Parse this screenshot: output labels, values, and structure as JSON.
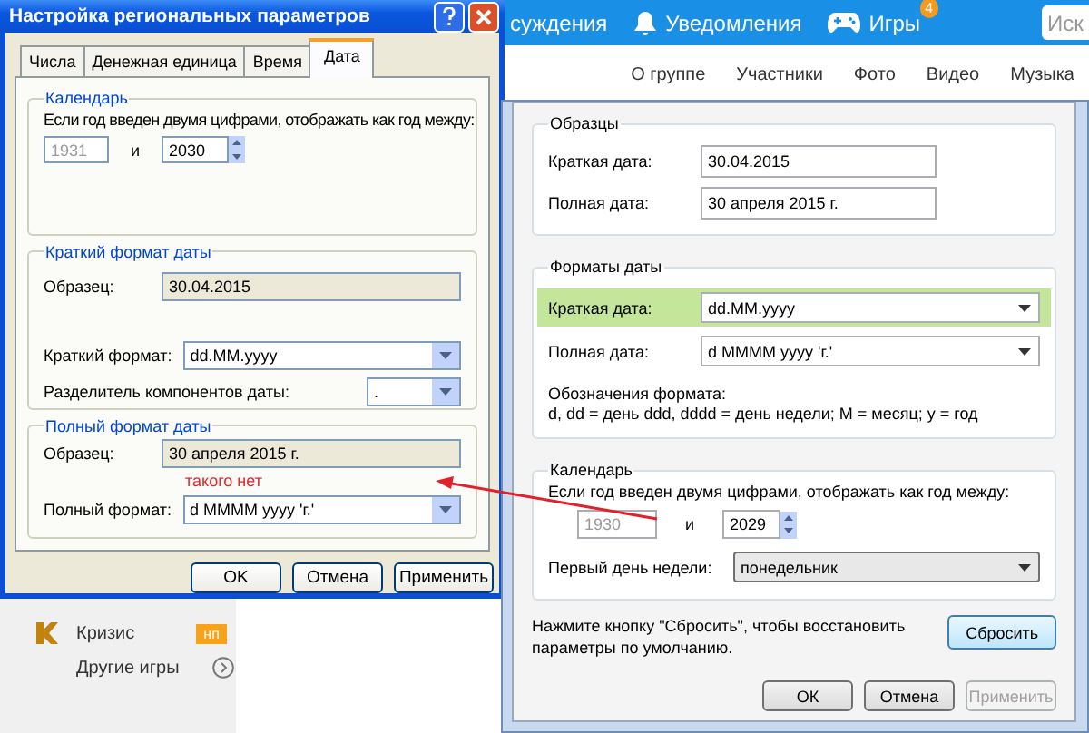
{
  "website": {
    "top_nav": [
      {
        "label": "суждения"
      },
      {
        "label": "Уведомления"
      },
      {
        "label": "Игры",
        "badge": "4"
      }
    ],
    "search": {
      "placeholder": "Иск"
    },
    "group_nav": [
      "О группе",
      "Участники",
      "Фото",
      "Видео",
      "Музыка"
    ],
    "sidebar": [
      {
        "label": "Кризис",
        "badge": "нп"
      },
      {
        "label": "Другие игры"
      }
    ]
  },
  "xp_dialog": {
    "title": "Настройка региональных параметров",
    "tabs": [
      {
        "label": "Числа",
        "selected": false
      },
      {
        "label": "Денежная единица",
        "selected": false
      },
      {
        "label": "Время",
        "selected": false
      },
      {
        "label": "Дата",
        "selected": true
      }
    ],
    "calendar": {
      "title": "Календарь",
      "text": "Если год введен двумя цифрами, отображать как год между:",
      "from": {
        "value": "1931",
        "disabled": true
      },
      "and": "и",
      "to": {
        "value": "2030",
        "disabled": false
      }
    },
    "short_format": {
      "title": "Краткий формат даты",
      "sample_label": "Образец:",
      "sample": "30.04.2015",
      "format_label": "Краткий формат:",
      "format": "dd.MM.yyyy",
      "separator_label": "Разделитель компонентов даты:",
      "separator": "."
    },
    "long_format": {
      "title": "Полный формат даты",
      "sample_label": "Образец:",
      "sample": "30 апреля 2015 г.",
      "note": "такого нет",
      "format_label": "Полный формат:",
      "format": "d MMMM yyyy 'г.'"
    },
    "buttons": [
      {
        "label": "OK",
        "disabled": false
      },
      {
        "label": "Отмена",
        "disabled": false
      },
      {
        "label": "Применить",
        "disabled": false
      }
    ]
  },
  "win7_dialog": {
    "samples": {
      "title": "Образцы",
      "rows": [
        {
          "label": "Краткая дата:",
          "value": "30.04.2015"
        },
        {
          "label": "Полная дата:",
          "value": "30 апреля 2015 г."
        }
      ]
    },
    "formats": {
      "title": "Форматы даты",
      "rows": [
        {
          "label": "Краткая дата:",
          "value": "dd.MM.yyyy",
          "highlighted": true
        },
        {
          "label": "Полная дата:",
          "value": "d MMMM yyyy 'г.'",
          "highlighted": false
        }
      ],
      "legend_title": "Обозначения формата:",
      "legend": "d, dd = день  ddd, dddd = день недели; M = месяц; y = год"
    },
    "calendar": {
      "title": "Календарь",
      "text": "Если год введен двумя цифрами, отображать как год между:",
      "from": {
        "value": "1930",
        "disabled": true
      },
      "and": "и",
      "to": {
        "value": "2029",
        "disabled": false
      },
      "first_day_label": "Первый день недели:",
      "first_day": "понедельник"
    },
    "reset_text": "Нажмите кнопку \"Сбросить\", чтобы восстановить параметры по умолчанию.",
    "reset_button": "Сбросить",
    "buttons": [
      {
        "label": "ОК",
        "disabled": false
      },
      {
        "label": "Отмена",
        "disabled": false
      },
      {
        "label": "Применить",
        "disabled": true
      }
    ]
  }
}
